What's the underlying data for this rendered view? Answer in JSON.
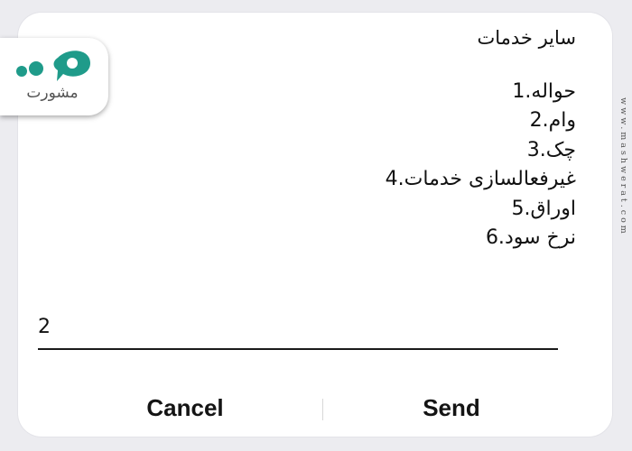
{
  "dialog": {
    "title": "ساير خدمات",
    "menu": [
      {
        "num": "1.",
        "text": "حواله"
      },
      {
        "num": "2.",
        "text": "وام"
      },
      {
        "num": "3.",
        "text": "چک"
      },
      {
        "num": "4.",
        "text": "غیرفعالسازی خدمات"
      },
      {
        "num": "5.",
        "text": "اوراق"
      },
      {
        "num": "6.",
        "text": "نرخ سود"
      }
    ],
    "input_value": "2",
    "cancel_label": "Cancel",
    "send_label": "Send"
  },
  "branding": {
    "logo_text": "مشورت",
    "watermark": "www.mashwerat.com",
    "logo_color": "#1f9b8a"
  }
}
